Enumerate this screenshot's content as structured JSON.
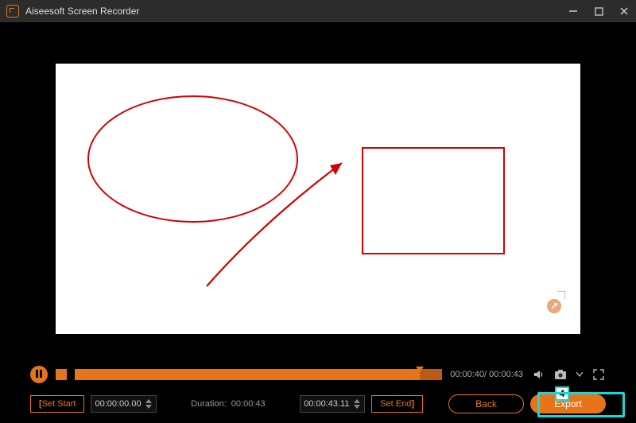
{
  "app": {
    "title": "Aiseesoft Screen Recorder"
  },
  "colors": {
    "accent": "#e8741a",
    "highlight": "#17d8d8"
  },
  "playback": {
    "current_time": "00:00:40",
    "total_time": "00:00:43"
  },
  "trim": {
    "set_start_label": "Set Start",
    "start_time": "00:00:00.00",
    "duration_label": "Duration:",
    "duration_value": "00:00:43",
    "end_time": "00:00:43.11",
    "set_end_label": "Set End"
  },
  "buttons": {
    "back": "Back",
    "export": "Export"
  },
  "callout": {
    "num": "4"
  },
  "icons": {
    "minimize": "minimize-icon",
    "maximize": "maximize-icon",
    "close": "close-icon",
    "volume": "volume-icon",
    "camera": "camera-icon",
    "fullscreen": "fullscreen-icon"
  }
}
